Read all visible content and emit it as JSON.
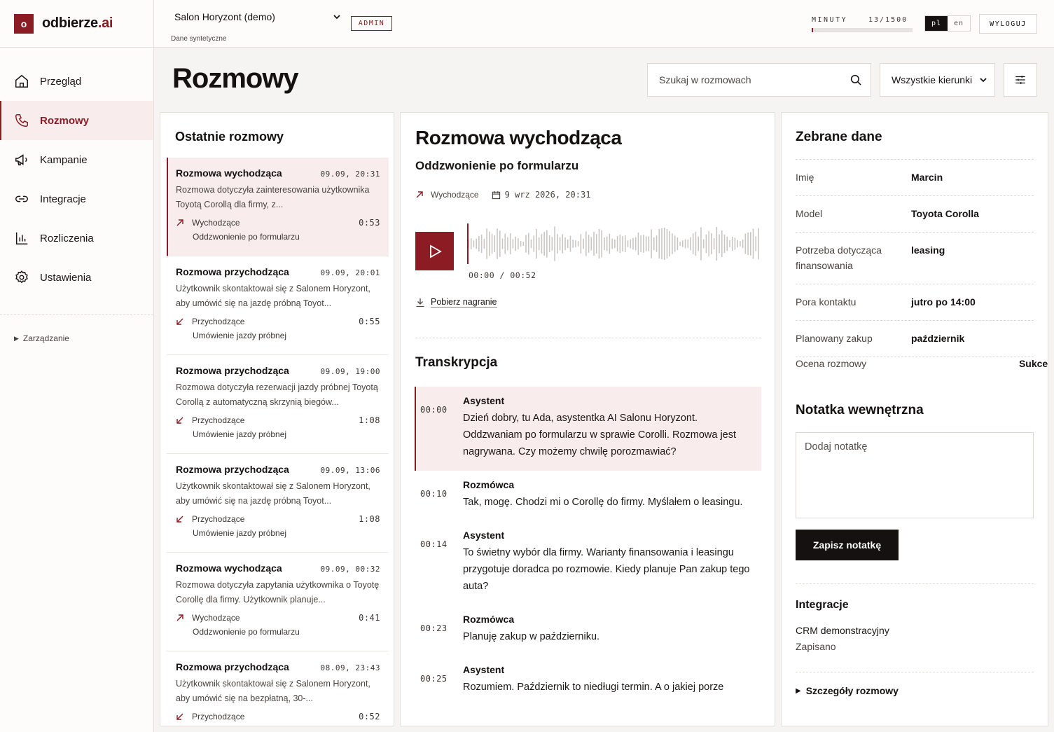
{
  "brand": {
    "initial": "o",
    "name": "odbierze",
    "suffix": ".ai",
    "color": "#8b1c24"
  },
  "sidebar": {
    "items": [
      {
        "label": "Przegląd",
        "icon": "home-icon"
      },
      {
        "label": "Rozmowy",
        "icon": "phone-icon",
        "active": true
      },
      {
        "label": "Kampanie",
        "icon": "megaphone-icon"
      },
      {
        "label": "Integracje",
        "icon": "link-icon"
      },
      {
        "label": "Rozliczenia",
        "icon": "bar-chart-icon"
      },
      {
        "label": "Ustawienia",
        "icon": "gear-icon"
      }
    ],
    "manage_label": "Zarządzanie"
  },
  "topbar": {
    "salon": "Salon Horyzont (demo)",
    "salon_sub": "Dane syntetyczne",
    "role": "ADMIN",
    "minutes_label": "MINUTY",
    "minutes_value": "13/1500",
    "minutes_fraction": 0.0087,
    "lang_active": "pl",
    "lang_other": "en",
    "logout": "WYLOGUJ"
  },
  "page": {
    "title": "Rozmowy",
    "search_placeholder": "Szukaj w rozmowach",
    "direction_filter": "Wszystkie kierunki"
  },
  "calls": {
    "heading": "Ostatnie rozmowy",
    "items": [
      {
        "title": "Rozmowa wychodząca",
        "date": "09.09, 20:31",
        "desc": "Rozmowa dotyczyła zainteresowania użytkownika Toyotą Corollą dla firmy, z...",
        "direction": "Wychodzące",
        "dir": "out",
        "duration": "0:53",
        "campaign": "Oddzwonienie po formularzu",
        "active": true
      },
      {
        "title": "Rozmowa przychodząca",
        "date": "09.09, 20:01",
        "desc": "Użytkownik skontaktował się z Salonem Horyzont, aby umówić się na jazdę próbną Toyot...",
        "direction": "Przychodzące",
        "dir": "in",
        "duration": "0:55",
        "campaign": "Umówienie jazdy próbnej"
      },
      {
        "title": "Rozmowa przychodząca",
        "date": "09.09, 19:00",
        "desc": "Rozmowa dotyczyła rezerwacji jazdy próbnej Toyotą Corollą z automatyczną skrzynią biegów...",
        "direction": "Przychodzące",
        "dir": "in",
        "duration": "1:08",
        "campaign": "Umówienie jazdy próbnej"
      },
      {
        "title": "Rozmowa przychodząca",
        "date": "09.09, 13:06",
        "desc": "Użytkownik skontaktował się z Salonem Horyzont, aby umówić się na jazdę próbną Toyot...",
        "direction": "Przychodzące",
        "dir": "in",
        "duration": "1:08",
        "campaign": "Umówienie jazdy próbnej"
      },
      {
        "title": "Rozmowa wychodząca",
        "date": "09.09, 00:32",
        "desc": "Rozmowa dotyczyła zapytania użytkownika o Toyotę Corollę dla firmy. Użytkownik planuje...",
        "direction": "Wychodzące",
        "dir": "out",
        "duration": "0:41",
        "campaign": "Oddzwonienie po formularzu"
      },
      {
        "title": "Rozmowa przychodząca",
        "date": "08.09, 23:43",
        "desc": "Użytkownik skontaktował się z Salonem Horyzont, aby umówić się na bezpłatną, 30-...",
        "direction": "Przychodzące",
        "dir": "in",
        "duration": "0:52",
        "campaign": ""
      }
    ]
  },
  "detail": {
    "title": "Rozmowa wychodząca",
    "subtitle": "Oddzwonienie po formularzu",
    "direction": "Wychodzące",
    "datetime": "9 wrz 2026, 20:31",
    "time": "00:00 / 00:52",
    "progress": 0,
    "download": "Pobierz nagranie",
    "transcript_heading": "Transkrypcja",
    "transcript": [
      {
        "t": "00:00",
        "who": "Asystent",
        "text": "Dzień dobry, tu Ada, asystentka AI Salonu Horyzont. Oddzwaniam po formularzu w sprawie Corolli. Rozmowa jest nagrywana. Czy możemy chwilę porozmawiać?",
        "active": true
      },
      {
        "t": "00:10",
        "who": "Rozmówca",
        "text": "Tak, mogę. Chodzi mi o Corollę do firmy. Myślałem o leasingu."
      },
      {
        "t": "00:14",
        "who": "Asystent",
        "text": "To świetny wybór dla firmy. Warianty finansowania i leasingu przygotuje doradca po rozmowie. Kiedy planuje Pan zakup tego auta?"
      },
      {
        "t": "00:23",
        "who": "Rozmówca",
        "text": "Planuję zakup w październiku."
      },
      {
        "t": "00:25",
        "who": "Asystent",
        "text": "Rozumiem. Październik to niedługi termin. A o jakiej porze"
      }
    ]
  },
  "collected": {
    "heading": "Zebrane dane",
    "fields": [
      {
        "k": "Imię",
        "v": "Marcin"
      },
      {
        "k": "Model",
        "v": "Toyota Corolla"
      },
      {
        "k": "Potrzeba dotycząca finansowania",
        "v": "leasing"
      },
      {
        "k": "Pora kontaktu",
        "v": "jutro po 14:00"
      },
      {
        "k": "Planowany zakup",
        "v": "październik"
      }
    ],
    "score_label": "Ocena rozmowy",
    "score_value": "Sukces",
    "note_heading": "Notatka wewnętrzna",
    "note_placeholder": "Dodaj notatkę",
    "save_note": "Zapisz notatkę",
    "integrations_heading": "Integracje",
    "crm_name": "CRM demonstracyjny",
    "crm_status": "Zapisano",
    "details_label": "Szczegóły rozmowy"
  }
}
